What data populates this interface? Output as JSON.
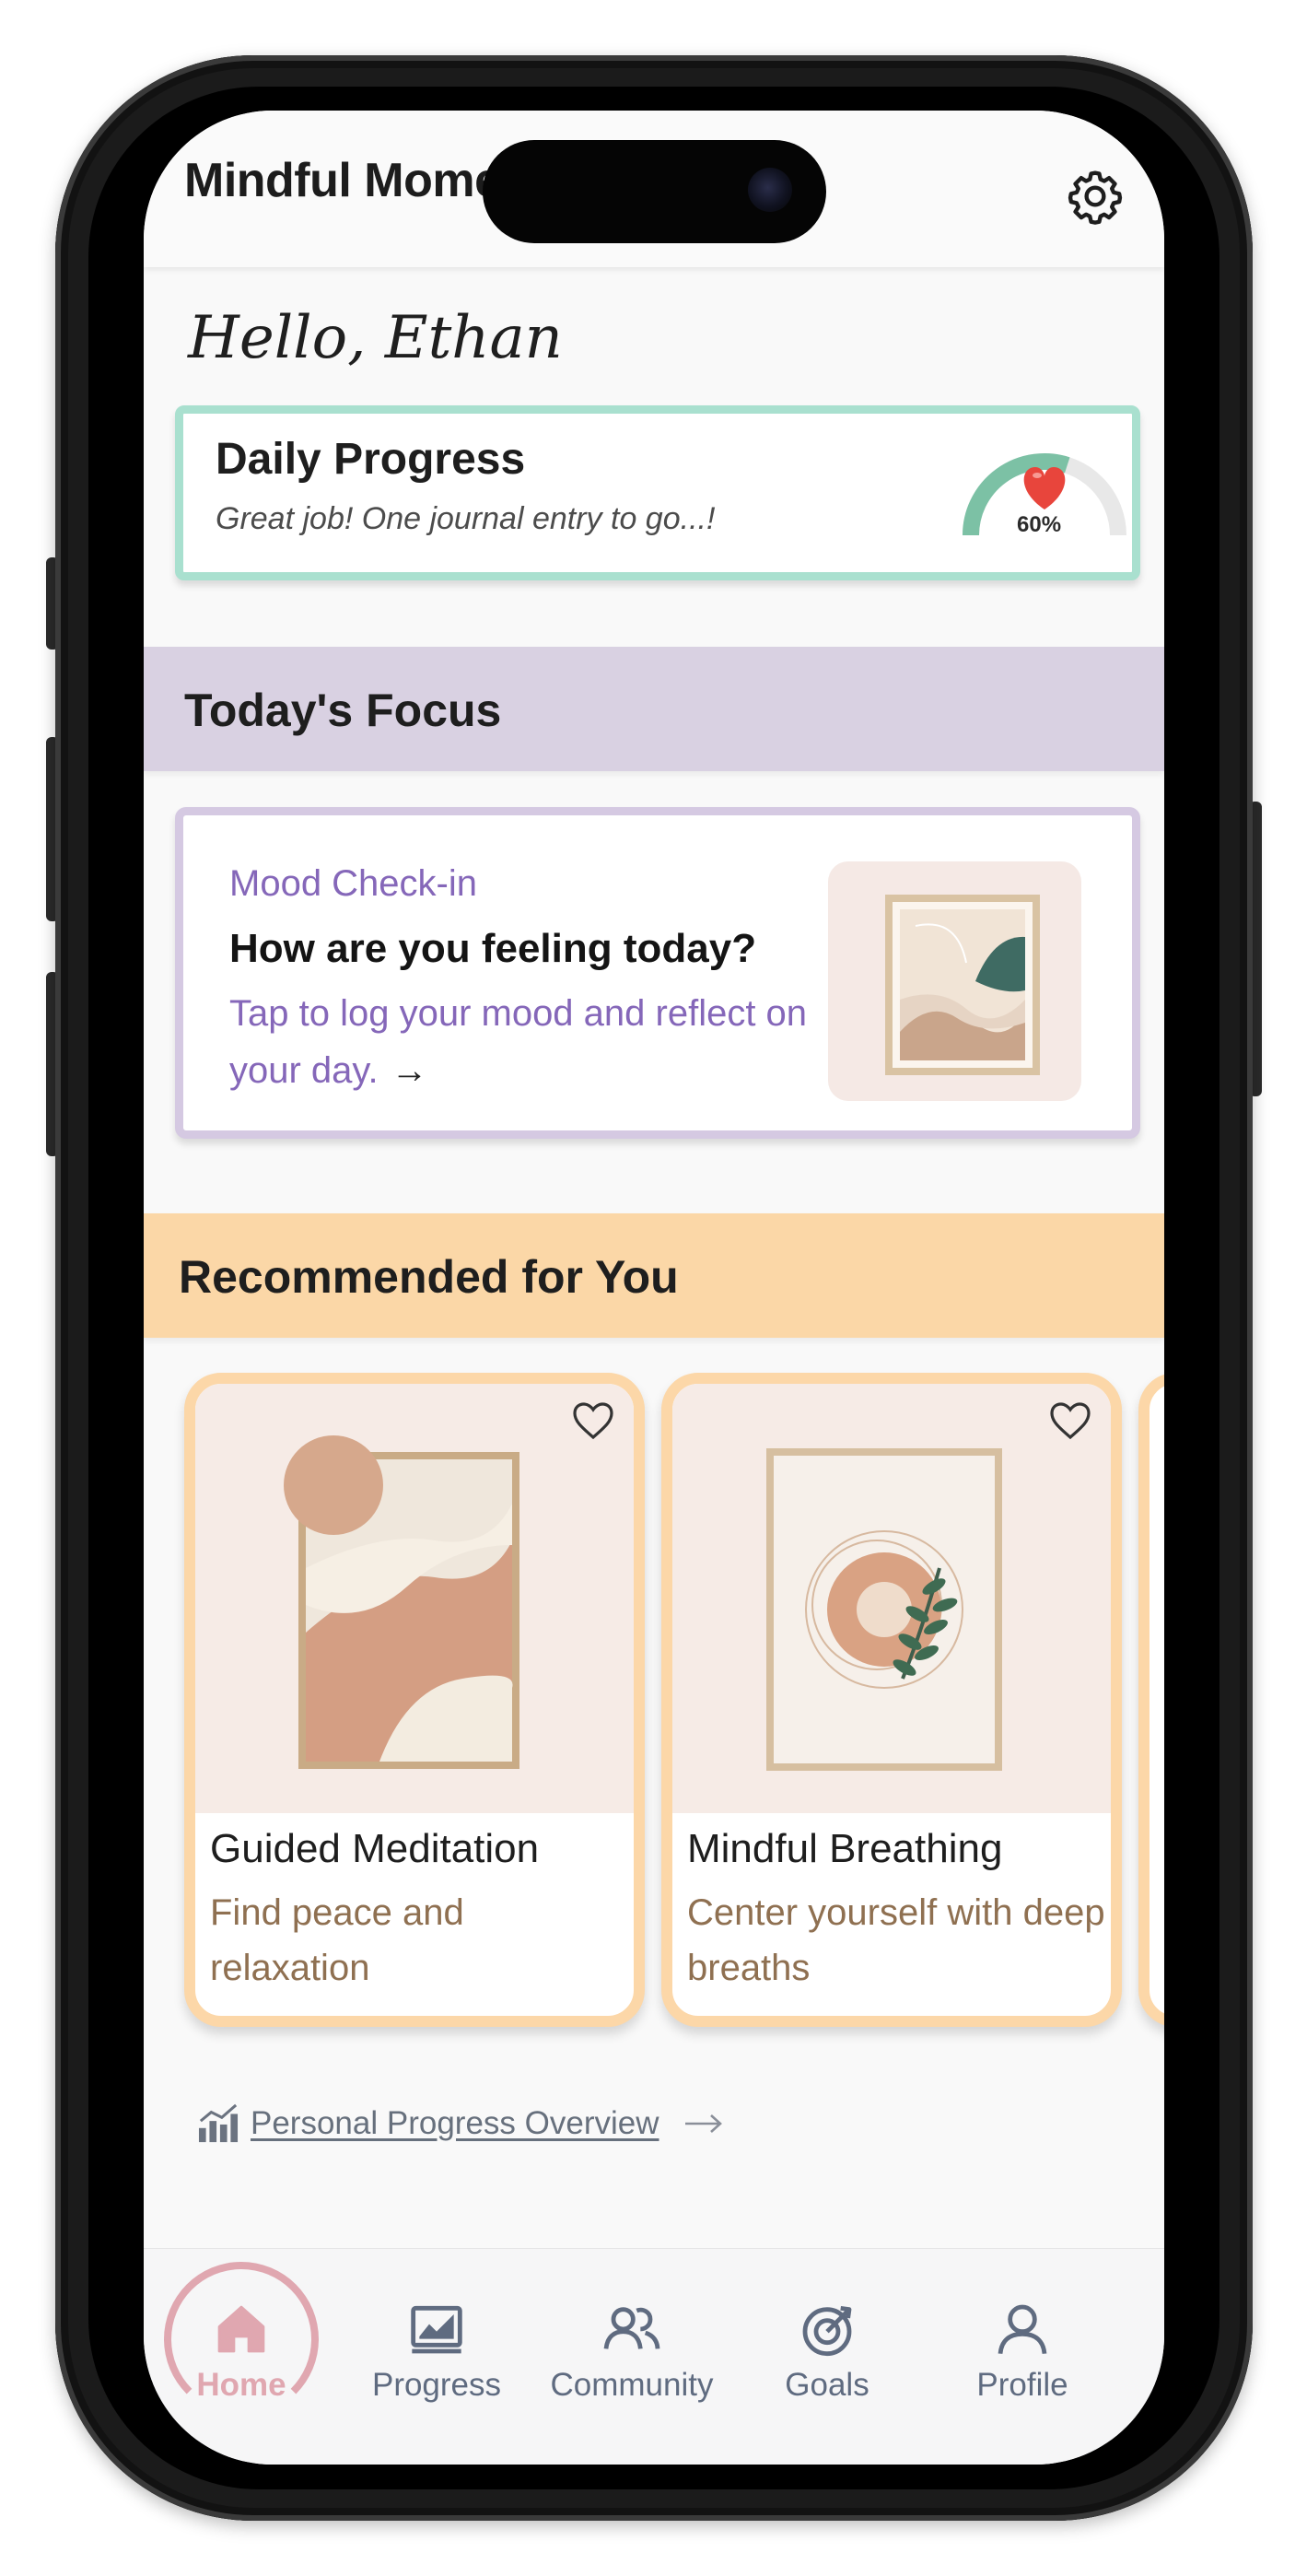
{
  "app": {
    "title": "Mindful Moments"
  },
  "greeting": "Hello, Ethan",
  "daily_progress": {
    "title": "Daily Progress",
    "subtitle": "Great job! One journal entry to go...!",
    "percent_label": "60%",
    "percent_value": 60
  },
  "todays_focus": {
    "heading": "Today's Focus",
    "card": {
      "label": "Mood Check-in",
      "title": "How are you feeling today?",
      "description": "Tap to log your mood and reflect on your day.",
      "arrow": "→"
    }
  },
  "recommended": {
    "heading": "Recommended for You",
    "items": [
      {
        "title": "Guided Meditation",
        "subtitle": "Find peace and relaxation"
      },
      {
        "title": "Mindful Breathing",
        "subtitle": "Center yourself with deep breaths"
      }
    ]
  },
  "overview_link": {
    "label": "Personal Progress Overview"
  },
  "tabs": [
    {
      "label": "Home",
      "icon": "home-icon",
      "active": true
    },
    {
      "label": "Progress",
      "icon": "chart-icon",
      "active": false
    },
    {
      "label": "Community",
      "icon": "community-icon",
      "active": false
    },
    {
      "label": "Goals",
      "icon": "target-icon",
      "active": false
    },
    {
      "label": "Profile",
      "icon": "user-icon",
      "active": false
    }
  ],
  "colors": {
    "progress_border": "#a9e0cf",
    "focus_band": "#d9d1e2",
    "recommended_band": "#fbd7a7",
    "accent_purple": "#8567b9",
    "active_tab": "#e0a7b0",
    "inactive_tab": "#5f6b80"
  }
}
